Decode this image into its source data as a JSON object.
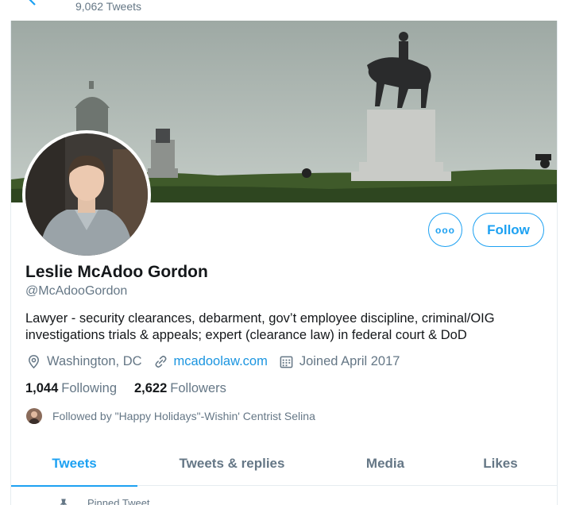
{
  "header": {
    "tweet_count": "9,062 Tweets"
  },
  "profile": {
    "name": "Leslie McAdoo Gordon",
    "handle": "@McAdooGordon",
    "bio": "Lawyer - security clearances, debarment, gov’t employee discipline, criminal/OIG investigations trials & appeals; expert (clearance law) in federal court & DoD",
    "location": "Washington, DC",
    "website": "mcadoolaw.com",
    "joined": "Joined April 2017",
    "following_count": "1,044",
    "following_label": "Following",
    "followers_count": "2,622",
    "followers_label": "Followers",
    "followed_by": "Followed by \"Happy Holidays\"-Wishin' Centrist Selina"
  },
  "buttons": {
    "more_label": "ooo",
    "follow_label": "Follow"
  },
  "tabs": [
    {
      "label": "Tweets"
    },
    {
      "label": "Tweets & replies"
    },
    {
      "label": "Media"
    },
    {
      "label": "Likes"
    }
  ],
  "pinned": {
    "label": "Pinned Tweet"
  },
  "colors": {
    "accent": "#1da1f2",
    "link": "#1b95e0",
    "secondary_text": "#657786",
    "primary_text": "#14171a"
  },
  "icons": {
    "back": "back-arrow-icon",
    "location": "location-pin-icon",
    "link": "link-icon",
    "calendar": "calendar-icon",
    "pin": "pin-icon"
  }
}
